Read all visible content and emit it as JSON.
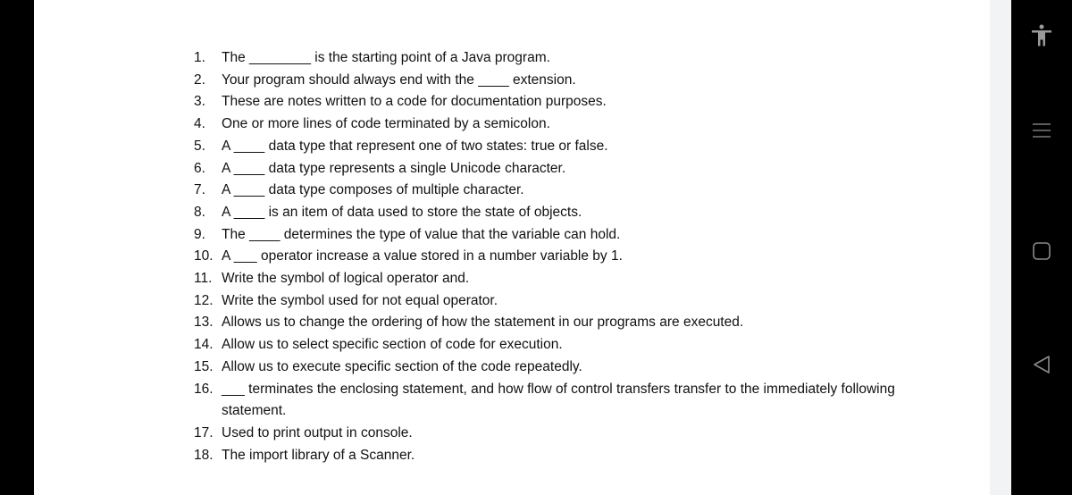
{
  "questions": [
    {
      "num": "1.",
      "text": "The ________ is the starting point of a Java program."
    },
    {
      "num": "2.",
      "text": "Your program should always end with the ____ extension."
    },
    {
      "num": "3.",
      "text": "These are notes written to a code for documentation purposes."
    },
    {
      "num": "4.",
      "text": "One or more lines of code terminated by a semicolon."
    },
    {
      "num": "5.",
      "text": "A ____ data type that represent one of two states: true or false."
    },
    {
      "num": "6.",
      "text": "A ____ data type represents a single Unicode character."
    },
    {
      "num": "7.",
      "text": "A ____ data type composes of multiple character."
    },
    {
      "num": "8.",
      "text": "A ____ is an item of data used to store the state of objects."
    },
    {
      "num": "9.",
      "text": "The ____ determines the type of value that the variable can hold."
    },
    {
      "num": "10.",
      "text": "A ___ operator increase a value stored in a number variable by 1."
    },
    {
      "num": "11.",
      "text": "Write the symbol of logical operator and."
    },
    {
      "num": "12.",
      "text": "Write the symbol used for not equal operator."
    },
    {
      "num": "13.",
      "text": "Allows us to change the ordering of how the statement in our programs are executed."
    },
    {
      "num": "14.",
      "text": "Allow us to select specific section of code for execution."
    },
    {
      "num": "15.",
      "text": "Allow us to execute specific section of the code repeatedly."
    },
    {
      "num": "16.",
      "text": "___ terminates the enclosing statement, and how flow of control transfers transfer to the immediately following statement."
    },
    {
      "num": "17.",
      "text": "Used to print output in console."
    },
    {
      "num": "18.",
      "text": "The import library of a Scanner."
    }
  ],
  "nav": {
    "icons": [
      "accessibility-icon",
      "recents-icon",
      "home-icon",
      "back-icon"
    ],
    "icon_color": "#9a9a9a"
  }
}
